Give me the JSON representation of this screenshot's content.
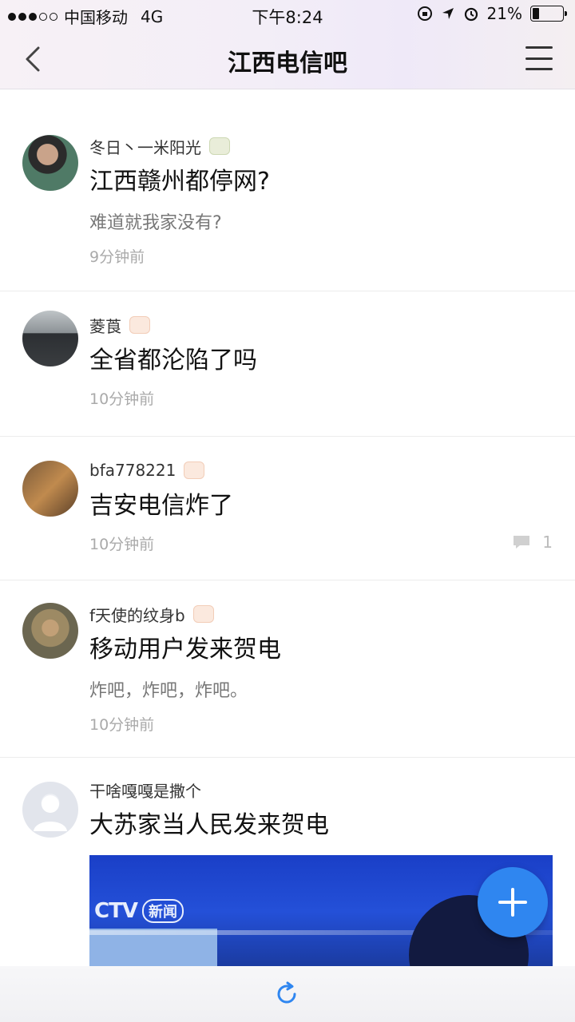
{
  "status_bar": {
    "carrier": "中国移动",
    "network": "4G",
    "time": "下午8:24",
    "battery": "21%",
    "battery_level": 0.21
  },
  "nav": {
    "title": "江西电信吧"
  },
  "posts": [
    {
      "author": "冬日丶一米阳光",
      "title": "江西赣州都停网?",
      "excerpt": "难道就我家没有?",
      "time": "9分钟前"
    },
    {
      "author": "菱莨",
      "title": "全省都沦陷了吗",
      "time": "10分钟前"
    },
    {
      "author": "bfa778221",
      "title": "吉安电信炸了",
      "time": "10分钟前",
      "comments": "1"
    },
    {
      "author": "f天使的纹身b",
      "title": "移动用户发来贺电",
      "excerpt": "炸吧，炸吧，炸吧。",
      "time": "10分钟前"
    },
    {
      "author": "干啥嘎嘎是撒个",
      "title": "大苏家当人民发来贺电",
      "media_caption": "新闻"
    }
  ],
  "colors": {
    "accent": "#2f86f0",
    "gradient_start": "#f7f1f6",
    "gradient_end": "#efe9f8"
  },
  "icons": {
    "back": "chevron-left-icon",
    "menu": "hamburger-menu-icon",
    "add": "plus-icon",
    "refresh": "refresh-icon",
    "comment": "comment-bubble-icon"
  }
}
